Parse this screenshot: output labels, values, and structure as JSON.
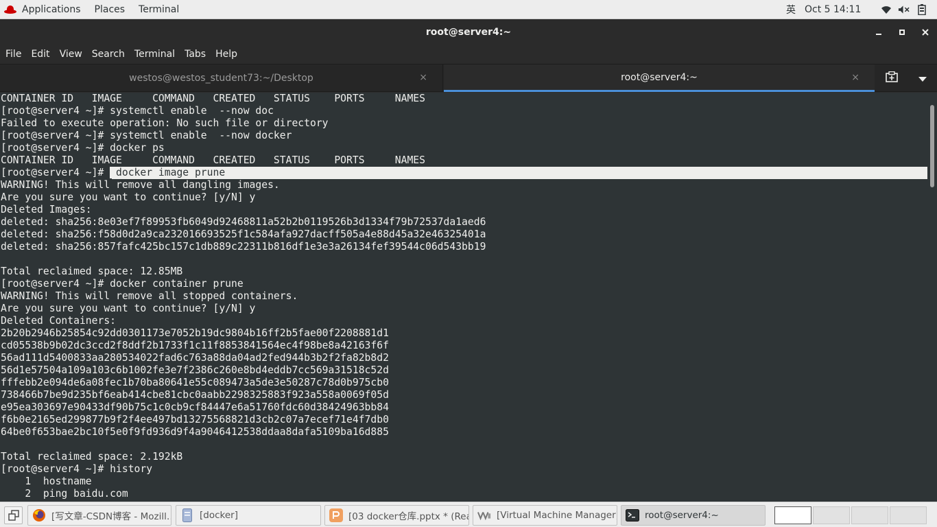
{
  "topbar": {
    "applications": "Applications",
    "places": "Places",
    "terminal": "Terminal",
    "ime": "英",
    "clock": "Oct 5  14:11"
  },
  "window": {
    "title": "root@server4:~",
    "min": "–",
    "max": "▫",
    "close": "✕"
  },
  "menu": [
    "File",
    "Edit",
    "View",
    "Search",
    "Terminal",
    "Tabs",
    "Help"
  ],
  "tabs": [
    {
      "label": "westos@westos_student73:~/Desktop",
      "close": "×"
    },
    {
      "label": "root@server4:~",
      "close": "×"
    }
  ],
  "terminal": {
    "lines": [
      "CONTAINER ID   IMAGE     COMMAND   CREATED   STATUS    PORTS     NAMES",
      "[root@server4 ~]# systemctl enable  --now doc",
      "Failed to execute operation: No such file or directory",
      "[root@server4 ~]# systemctl enable  --now docker",
      "[root@server4 ~]# docker ps",
      "CONTAINER ID   IMAGE     COMMAND   CREATED   STATUS    PORTS     NAMES",
      "[root@server4 ~]# ",
      "WARNING! This will remove all dangling images.",
      "Are you sure you want to continue? [y/N] y",
      "Deleted Images:",
      "deleted: sha256:8e03ef7f89953fb6049d92468811a52b2b0119526b3d1334f79b72537da1aed6",
      "deleted: sha256:f58d0d2a9ca232016693525f1c584afa927dacff505a4e88d45a32e46325401a",
      "deleted: sha256:857fafc425bc157c1db889c22311b816df1e3e3a26134fef39544c06d543bb19",
      "",
      "Total reclaimed space: 12.85MB",
      "[root@server4 ~]# docker container prune",
      "WARNING! This will remove all stopped containers.",
      "Are you sure you want to continue? [y/N] y",
      "Deleted Containers:",
      "2b20b2946b25854c92dd0301173e7052b19dc9804b16ff2b5fae00f2208881d1",
      "cd05538b9b02dc3ccd2f8ddf2b1733f1c11f8853841564ec4f98be8a42163f6f",
      "56ad111d5400833aa280534022fad6c763a88da04ad2fed944b3b2f2fa82b8d2",
      "56d1e57504a109a103c6b1002fe3e7f2386c260e8bd4eddb7cc569a31518c52d",
      "fffebb2e094de6a08fec1b70ba80641e55c089473a5de3e50287c78d0b975cb0",
      "738466b7be9d235bf6eab414cbe81cbc0aabb2298325883f923a558a0069f05d",
      "e95ea303697e90433df90b75c1c0cb9cf84447e6a51760fdc60d38424963bb84",
      "f6b0e2165ed299877b9f2f4ee497bd13275568821d3cb2c07a7ecef71e4f7db0",
      "64be0f653bae2bc10f5e0f9fd936d9f4a9046412538ddaa8dafa5109ba16d885",
      "",
      "Total reclaimed space: 2.192kB",
      "[root@server4 ~]# history",
      "    1  hostname",
      "    2  ping baidu.com"
    ],
    "selected_command": " docker image prune"
  },
  "taskbar": {
    "tasks": [
      {
        "label": "[写文章-CSDN博客 - Mozill…",
        "icon": "firefox-icon"
      },
      {
        "label": "[docker]",
        "icon": "file-manager-icon"
      },
      {
        "label": "[03 docker仓库.pptx * (Rea…",
        "icon": "presentation-icon"
      },
      {
        "label": "[Virtual Machine Manager]",
        "icon": "vm-manager-icon"
      },
      {
        "label": "root@server4:~",
        "icon": "terminal-icon"
      }
    ]
  },
  "colors": {
    "terminal_bg": "#2e3436",
    "terminal_fg": "#eeeeec",
    "tab_accent": "#4a90d9",
    "topbar_bg": "#ededed"
  }
}
